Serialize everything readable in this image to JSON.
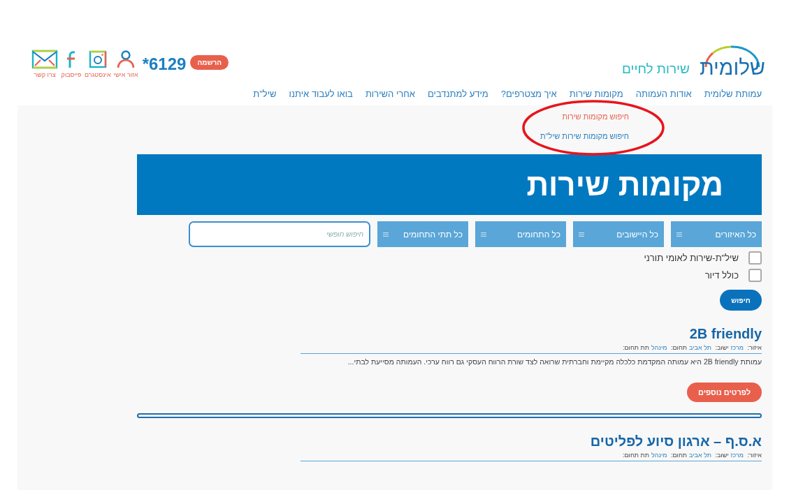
{
  "header": {
    "logo": "שלומית",
    "tagline": "שירות לחיים",
    "register_button": "הרשמה",
    "phone": "*6129",
    "links": [
      {
        "kind": "person",
        "label": "אזור אישי"
      },
      {
        "kind": "instagram",
        "label": "אינסטגרם"
      },
      {
        "kind": "facebook",
        "label": "פייסבוק"
      },
      {
        "kind": "mail",
        "label": "צרו קשר"
      }
    ]
  },
  "nav": [
    "עמותת שלומית",
    "אודות העמותה",
    "מקומות שירות",
    "איך מצטרפים?",
    "מידע למתנדבים",
    "אחרי השירות",
    "בואו לעבוד איתנו",
    "שיל\"ת"
  ],
  "dropdown": [
    {
      "label": "חיפוש מקומות שירות",
      "selected": true
    },
    {
      "label": "חיפוש מקומות שירות שיל\"ת",
      "selected": false
    }
  ],
  "banner": {
    "title": "מקומות שירות"
  },
  "filters": {
    "selects": [
      "כל האיזורים",
      "כל היישובים",
      "כל התחומים",
      "כל תתי התחומים"
    ],
    "search": {
      "placeholder": "חיפוש חופשי"
    }
  },
  "checkboxes": [
    {
      "label": "שיל\"ת-שירות לאומי תורני",
      "checked": false
    },
    {
      "label": "כולל דיור",
      "checked": false
    }
  ],
  "search_button": "חיפוש",
  "results": [
    {
      "title": "2B friendly",
      "meta": [
        {
          "label": "איזור:",
          "value": "מרכז"
        },
        {
          "label": "ישוב:",
          "value": "תל אביב"
        },
        {
          "label": "תחום:",
          "value": "מינהל"
        },
        {
          "label": "תת תחום:"
        }
      ],
      "description": "עמותת 2B friendly היא עמותה המקדמת כלכלה מקיימת וחברתית שרואה לצד שורת הרווח העסקי גם רווח ערכי. העמותה מסייעת לבתי...",
      "button": "לפרטים נוספים"
    },
    {
      "title": "א.ס.ף – ארגון סיוע לפליטים",
      "meta": [
        {
          "label": "איזור:",
          "value": "מרכז"
        },
        {
          "label": "ישוב:",
          "value": "תל אביב"
        },
        {
          "label": "תחום:",
          "value": "מינהל"
        },
        {
          "label": "תת תחום:"
        }
      ]
    }
  ]
}
